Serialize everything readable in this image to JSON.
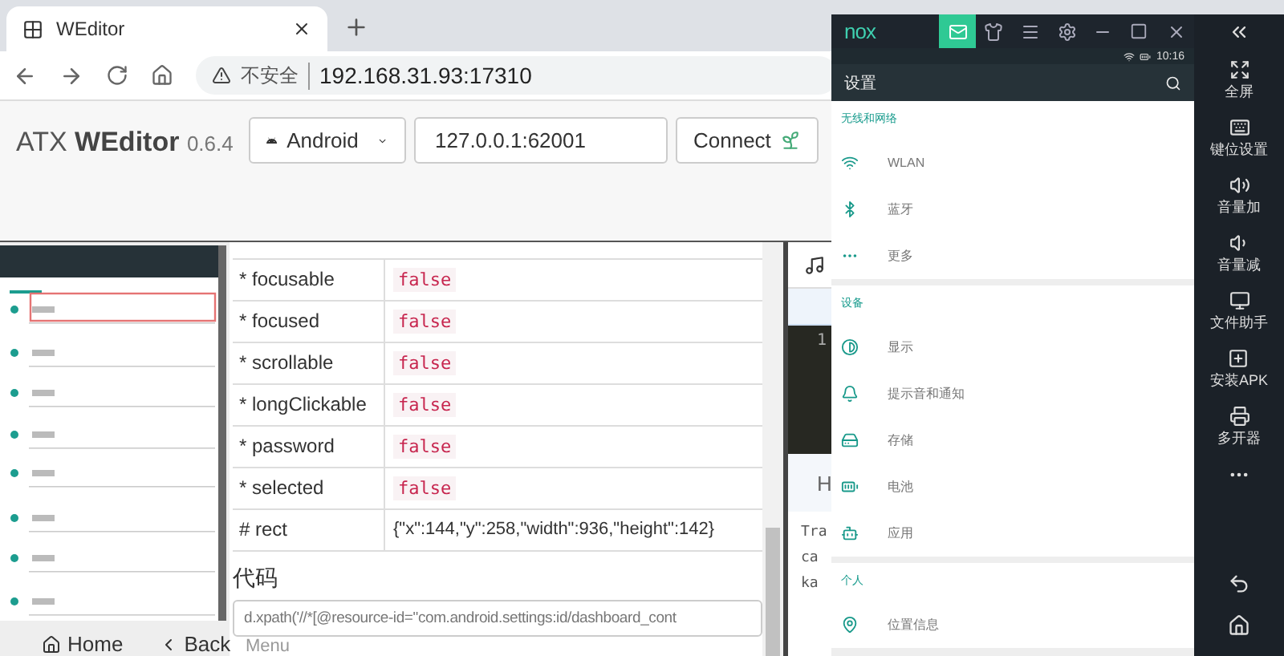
{
  "browser": {
    "tab_title": "WEditor",
    "security": "不安全",
    "url": "192.168.31.93:17310"
  },
  "header": {
    "brand": "ATX",
    "brand_bold": "WEditor",
    "version": "0.6.4",
    "platform": "Android",
    "address": "127.0.0.1:62001",
    "connect": "Connect"
  },
  "properties": [
    {
      "name": "* focusable",
      "value": "false",
      "kind": "code"
    },
    {
      "name": "* focused",
      "value": "false",
      "kind": "code"
    },
    {
      "name": "* scrollable",
      "value": "false",
      "kind": "code"
    },
    {
      "name": "* longClickable",
      "value": "false",
      "kind": "code"
    },
    {
      "name": "* password",
      "value": "false",
      "kind": "code"
    },
    {
      "name": "* selected",
      "value": "false",
      "kind": "code"
    },
    {
      "name": "# rect",
      "value": "{\"x\":144,\"y\":258,\"width\":936,\"height\":142}",
      "kind": "plain"
    }
  ],
  "code_section": {
    "title": "代码",
    "code": "d.xpath('//*[@resource-id=\"com.android.settings:id/dashboard_cont",
    "next_label": "Menu"
  },
  "device_buttons": [
    {
      "label": "Home"
    },
    {
      "label": "Back"
    }
  ],
  "side_pane": {
    "line_number": "1",
    "heading": "H",
    "lines": [
      "Tra",
      "ca",
      "ka"
    ]
  },
  "emulator": {
    "logo": "nox",
    "toolbar": [
      {
        "selected": true
      },
      {
        "selected": false
      },
      {
        "selected": false
      },
      {
        "selected": false
      }
    ],
    "status_time": "10:16",
    "app_title": "设置",
    "sections": [
      {
        "title": "无线和网络",
        "items": [
          "WLAN",
          "蓝牙",
          "更多"
        ]
      },
      {
        "title": "设备",
        "items": [
          "显示",
          "提示音和通知",
          "存储",
          "电池",
          "应用"
        ]
      },
      {
        "title": "个人",
        "items": [
          "位置信息"
        ]
      }
    ],
    "side_actions": [
      "全屏",
      "键位设置",
      "音量加",
      "音量减",
      "文件助手",
      "安装APK",
      "多开器"
    ]
  }
}
